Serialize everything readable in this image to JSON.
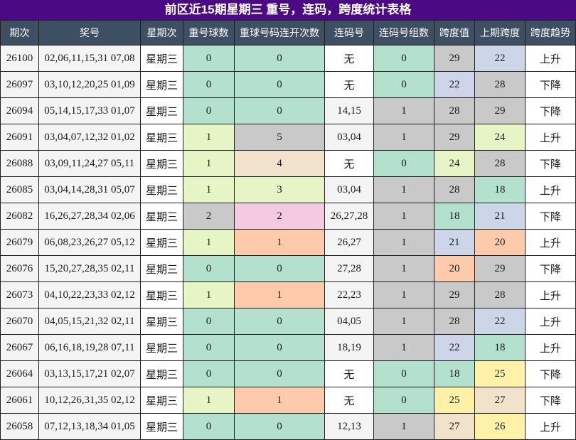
{
  "colors": {
    "title_bg": "#4b0a84",
    "header_bg": "#3e4f63",
    "grid_line": "#1e1e1e"
  },
  "chart_data": {
    "type": "table",
    "title": "前区近15期星期三 重号，连码，跨度统计表格",
    "columns": [
      "期次",
      "奖号",
      "星期次",
      "重号球数",
      "重球号码连开次数",
      "连码号",
      "连码号组数",
      "跨度值",
      "上期跨度",
      "跨度趋势"
    ],
    "rows": [
      [
        "26100",
        "02,06,11,15,31 07,08",
        "星期三",
        "0",
        "0",
        "无",
        "0",
        "29",
        "22",
        "上升"
      ],
      [
        "26097",
        "03,10,12,20,25 01,09",
        "星期三",
        "0",
        "0",
        "无",
        "0",
        "22",
        "28",
        "下降"
      ],
      [
        "26094",
        "05,14,15,17,33 01,07",
        "星期三",
        "0",
        "0",
        "14,15",
        "1",
        "28",
        "29",
        "下降"
      ],
      [
        "26091",
        "03,04,07,12,32 01,02",
        "星期三",
        "1",
        "5",
        "03,04",
        "1",
        "29",
        "24",
        "上升"
      ],
      [
        "26088",
        "03,09,11,24,27 05,11",
        "星期三",
        "1",
        "4",
        "无",
        "0",
        "24",
        "28",
        "下降"
      ],
      [
        "26085",
        "03,04,14,28,31 05,07",
        "星期三",
        "1",
        "3",
        "03,04",
        "1",
        "28",
        "18",
        "上升"
      ],
      [
        "26082",
        "16,26,27,28,34 02,06",
        "星期三",
        "2",
        "2",
        "26,27,28",
        "1",
        "18",
        "21",
        "下降"
      ],
      [
        "26079",
        "06,08,23,26,27 05,12",
        "星期三",
        "1",
        "1",
        "26,27",
        "1",
        "21",
        "20",
        "上升"
      ],
      [
        "26076",
        "15,20,27,28,35 02,11",
        "星期三",
        "0",
        "0",
        "27,28",
        "1",
        "20",
        "29",
        "下降"
      ],
      [
        "26073",
        "04,10,22,23,33 02,12",
        "星期三",
        "1",
        "1",
        "22,23",
        "1",
        "29",
        "28",
        "上升"
      ],
      [
        "26070",
        "04,05,15,21,32 02,11",
        "星期三",
        "0",
        "0",
        "04,05",
        "1",
        "28",
        "22",
        "上升"
      ],
      [
        "26067",
        "06,16,18,19,28 07,11",
        "星期三",
        "0",
        "0",
        "18,19",
        "1",
        "22",
        "18",
        "上升"
      ],
      [
        "26064",
        "03,13,15,17,21 02,07",
        "星期三",
        "0",
        "0",
        "无",
        "0",
        "18",
        "25",
        "下降"
      ],
      [
        "26061",
        "10,12,26,31,35 02,12",
        "星期三",
        "1",
        "1",
        "无",
        "0",
        "25",
        "27",
        "下降"
      ],
      [
        "26058",
        "07,12,13,18,34 01,05",
        "星期三",
        "0",
        "0",
        "12,13",
        "1",
        "27",
        "26",
        "上升"
      ]
    ],
    "cell_colors": [
      {
        "*": "#f4f4f4"
      },
      {
        "*": "#f4f4f4"
      },
      {
        "*": "#ffffff"
      },
      {
        "0": "#b4e1cd",
        "1": "#e6f4c6",
        "2": "#c9c9c9"
      },
      {
        "0": "#b4e1cd",
        "1": "#fdcbab",
        "2": "#f4c9e2",
        "3": "#e6f4c6",
        "4": "#f1e2cc",
        "5": "#c9c9c9"
      },
      {
        "无": "#ffffff",
        "*": "#f4f4f4"
      },
      {
        "0": "#b4e1cd",
        "1": "#c9c9c9"
      },
      {
        "18": "#b4e1cd",
        "20": "#fdcbab",
        "21": "#cdd6e8",
        "22": "#cdd6e8",
        "24": "#e6f4c6",
        "25": "#fff1a8",
        "26": "#fff1a8",
        "27": "#f1e2cc",
        "28": "#c9c9c9",
        "29": "#c9c9c9"
      },
      {
        "18": "#b4e1cd",
        "20": "#fdcbab",
        "21": "#cdd6e8",
        "22": "#cdd6e8",
        "24": "#e6f4c6",
        "25": "#fff1a8",
        "26": "#fff1a8",
        "27": "#f1e2cc",
        "28": "#c9c9c9",
        "29": "#c9c9c9"
      },
      {
        "*": "#ffffff"
      }
    ]
  }
}
